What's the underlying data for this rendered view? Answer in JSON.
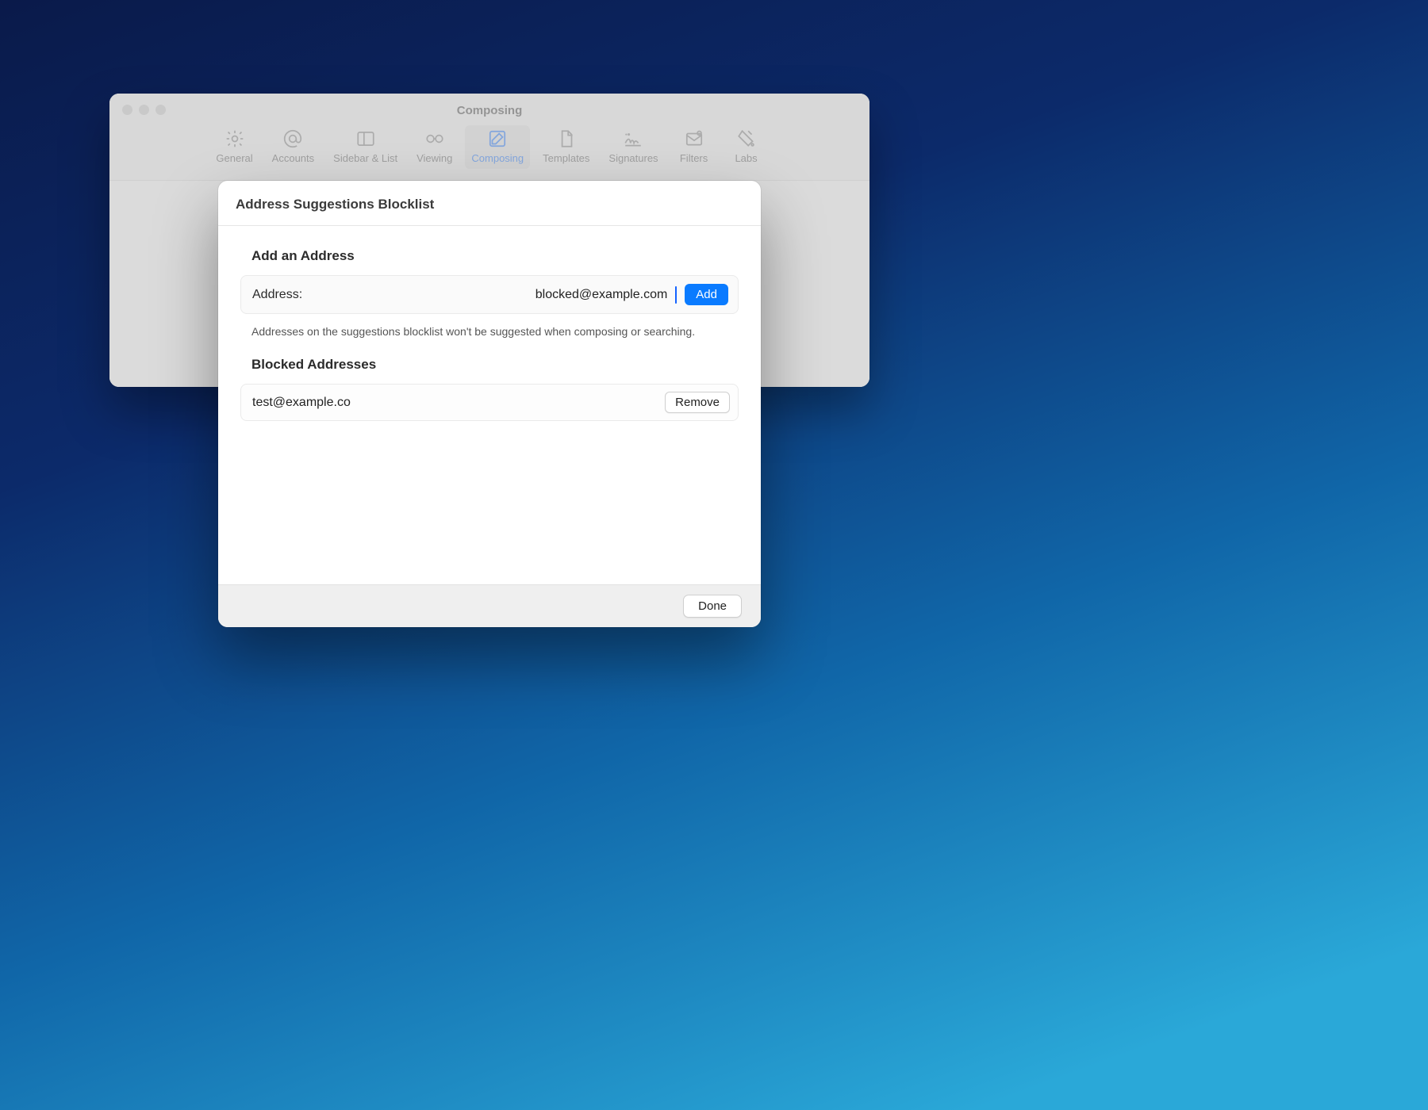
{
  "window": {
    "title": "Composing",
    "toolbar": [
      {
        "label": "General"
      },
      {
        "label": "Accounts"
      },
      {
        "label": "Sidebar & List"
      },
      {
        "label": "Viewing"
      },
      {
        "label": "Composing"
      },
      {
        "label": "Templates"
      },
      {
        "label": "Signatures"
      },
      {
        "label": "Filters"
      },
      {
        "label": "Labs"
      }
    ]
  },
  "sheet": {
    "title": "Address Suggestions Blocklist",
    "add_section_title": "Add an Address",
    "address_label": "Address:",
    "address_value": "blocked@example.com",
    "add_button": "Add",
    "help_text": "Addresses on the suggestions blocklist won't be suggested when composing or searching.",
    "blocked_section_title": "Blocked Addresses",
    "blocked": [
      {
        "email": "test@example.co",
        "remove_label": "Remove"
      }
    ],
    "done_button": "Done"
  }
}
